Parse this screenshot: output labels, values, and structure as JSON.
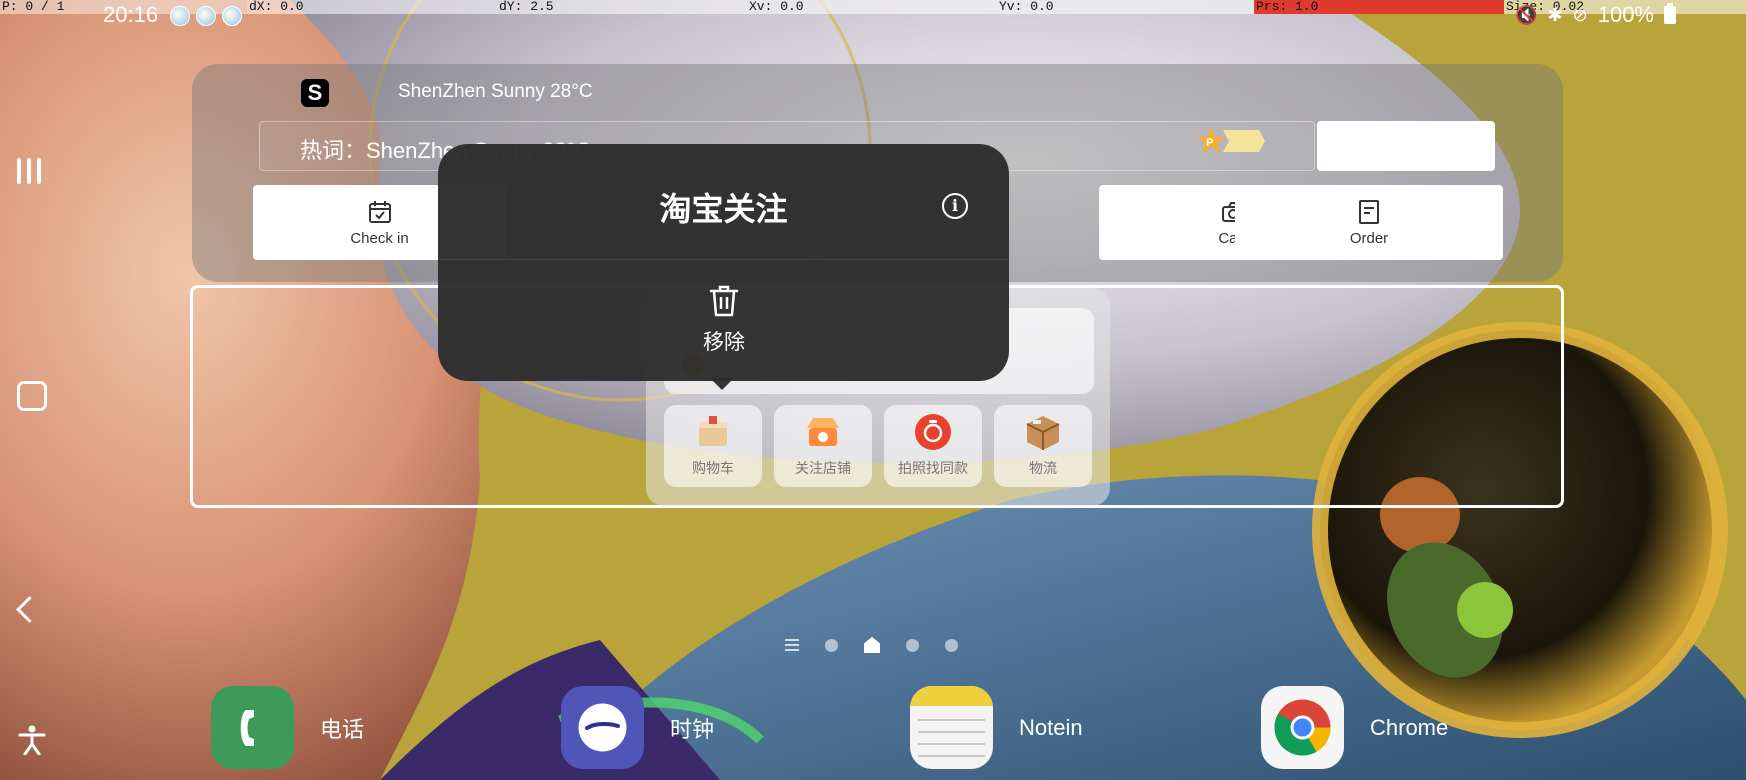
{
  "pointer_info": {
    "p": "P: 0 / 1",
    "dx": "dX: 0.0",
    "dy": "dY: 2.5",
    "xv": "Xv: 0.0",
    "yv": "Yv: 0.0",
    "prs": "Prs: 1.0",
    "size": "Size: 0.02"
  },
  "status_bar": {
    "time": "20:16",
    "battery": "100%"
  },
  "search_widget": {
    "logo": "S",
    "weather": "ShenZhen Sunny 28°C",
    "hot_word": "热词：ShenZhen Sunny 28°C",
    "buttons": [
      {
        "label": "Check in",
        "icon": "calendar-check-icon"
      },
      {
        "label": "Cart",
        "icon": "camera-icon"
      },
      {
        "label": "Order",
        "icon": "order-document-icon"
      }
    ]
  },
  "popup": {
    "title": "淘宝关注",
    "info_icon": "i",
    "remove_label": "移除"
  },
  "taobao_widget": {
    "tiles": [
      {
        "label": "购物车",
        "icon": "shopping-cart-icon"
      },
      {
        "label": "关注店铺",
        "icon": "shop-icon"
      },
      {
        "label": "拍照找同款",
        "icon": "camera-search-icon"
      },
      {
        "label": "物流",
        "icon": "package-icon"
      }
    ]
  },
  "dock": [
    {
      "label": "电话",
      "icon": "phone-app-icon",
      "color": "#3d9a5b"
    },
    {
      "label": "时钟",
      "icon": "clock-app-icon",
      "color": "#4f56b8"
    },
    {
      "label": "Notein",
      "icon": "notein-app-icon",
      "color": "#f3f3f3"
    },
    {
      "label": "Chrome",
      "icon": "chrome-app-icon",
      "color": "#f5f5f5"
    }
  ],
  "colors": {
    "pressure_highlight": "#e03a2e",
    "popup_background": "#2d2d2d"
  }
}
